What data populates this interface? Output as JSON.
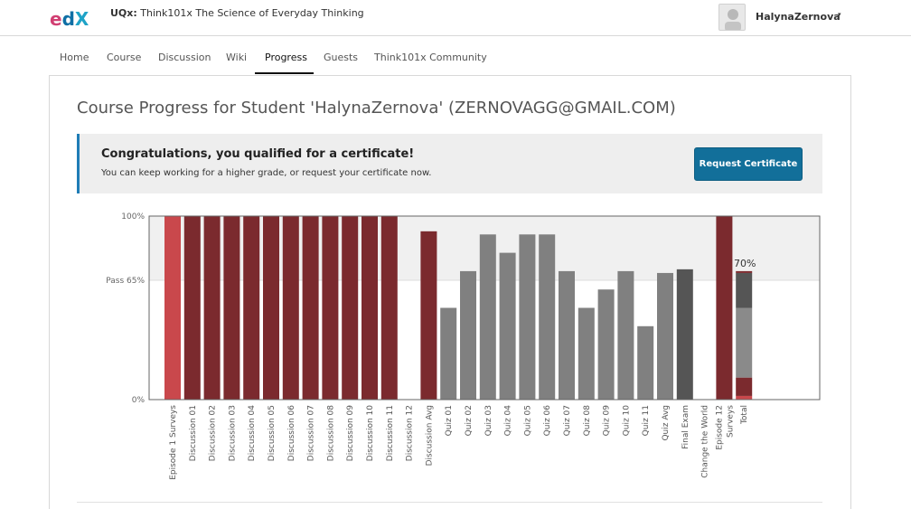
{
  "header": {
    "course_org": "UQx:",
    "course_name": "Think101x The Science of Everyday Thinking",
    "username": "HalynaZernova",
    "caret": "▾",
    "logo_text": "edX"
  },
  "nav": {
    "tabs": [
      {
        "label": "Home"
      },
      {
        "label": "Course"
      },
      {
        "label": "Discussion"
      },
      {
        "label": "Wiki"
      },
      {
        "label": "Progress"
      },
      {
        "label": "Guests"
      },
      {
        "label": "Think101x Community"
      }
    ],
    "active_tab": "Progress"
  },
  "main": {
    "title": "Course Progress for Student 'HalynaZernova' (ZERNOVAGG@GMAIL.COM)"
  },
  "banner": {
    "title": "Congratulations, you qualified for a certificate!",
    "text": "You can keep working for a higher grade, or request your certificate now.",
    "button_label": "Request Certificate"
  },
  "colors": {
    "accent": "#126f9a",
    "discussion": "#7b2a2e",
    "survey": "#c9484c",
    "quiz": "#808080",
    "exam": "#555555"
  },
  "chart_data": {
    "type": "bar",
    "ytick_labels": [
      "100%",
      "Pass 65%",
      "0%"
    ],
    "yticks": [
      100,
      65,
      0
    ],
    "ylim": [
      0,
      100
    ],
    "pass_threshold": 65,
    "categories": [
      "Episode 1 Surveys",
      "Discussion 01",
      "Discussion 02",
      "Discussion 03",
      "Discussion 04",
      "Discussion 05",
      "Discussion 06",
      "Discussion 07",
      "Discussion 08",
      "Discussion 09",
      "Discussion 10",
      "Discussion 11",
      "Discussion 12",
      "Discussion Avg",
      "Quiz 01",
      "Quiz 02",
      "Quiz 03",
      "Quiz 04",
      "Quiz 05",
      "Quiz 06",
      "Quiz 07",
      "Quiz 08",
      "Quiz 09",
      "Quiz 10",
      "Quiz 11",
      "Quiz Avg",
      "Final Exam",
      "Change the World",
      "Episode 12 Surveys",
      "Total"
    ],
    "values": [
      100,
      100,
      100,
      100,
      100,
      100,
      100,
      100,
      100,
      100,
      100,
      100,
      0,
      91.7,
      50,
      70,
      90,
      80,
      90,
      90,
      70,
      50,
      60,
      70,
      40,
      69,
      71,
      0,
      100,
      70
    ],
    "groups": [
      "survey",
      "discussion",
      "discussion",
      "discussion",
      "discussion",
      "discussion",
      "discussion",
      "discussion",
      "discussion",
      "discussion",
      "discussion",
      "discussion",
      "discussion",
      "discussion",
      "quiz",
      "quiz",
      "quiz",
      "quiz",
      "quiz",
      "quiz",
      "quiz",
      "quiz",
      "quiz",
      "quiz",
      "quiz",
      "quiz",
      "exam",
      "exam",
      "discussion",
      "total"
    ],
    "total": {
      "label": "70%",
      "value": 70,
      "segments": [
        {
          "group": "survey",
          "value": 2
        },
        {
          "group": "discussion",
          "value": 10
        },
        {
          "group": "quiz",
          "value": 38
        },
        {
          "group": "exam",
          "value": 19
        },
        {
          "group": "discussion",
          "value": 1
        }
      ]
    }
  }
}
